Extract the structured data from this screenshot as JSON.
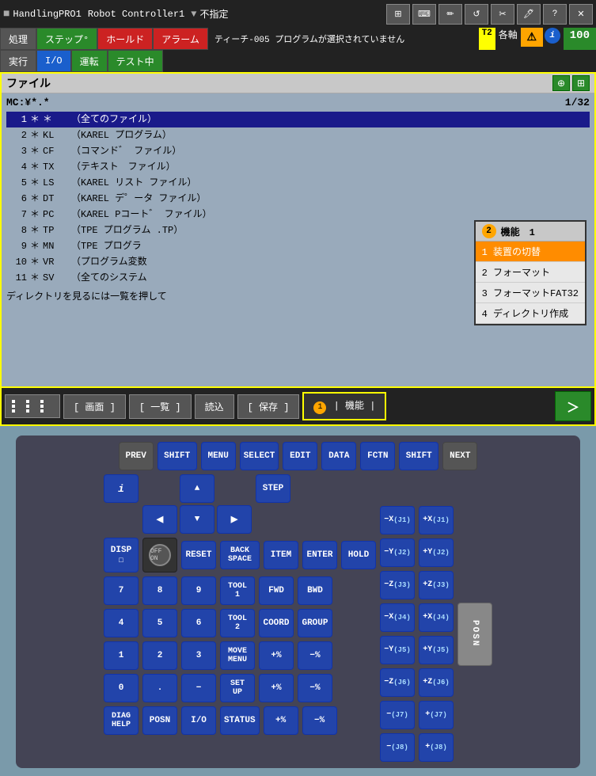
{
  "app": {
    "title": "HandlingPRO1",
    "controller": "Robot Controller1",
    "unspecified": "不指定"
  },
  "top_icons": [
    "grid-icon",
    "keyboard-icon",
    "pen-icon",
    "refresh-icon",
    "tool-icon",
    "pen2-icon",
    "question-icon",
    "x-icon"
  ],
  "menu": {
    "items": [
      {
        "label": "処理",
        "style": "gray"
      },
      {
        "label": "ステップ°",
        "style": "green"
      },
      {
        "label": "ホールド",
        "style": "red"
      },
      {
        "label": "アラーム",
        "style": "red"
      },
      {
        "label": "実行",
        "style": "gray"
      },
      {
        "label": "I/O",
        "style": "active-blue"
      },
      {
        "label": "運転",
        "style": "green"
      },
      {
        "label": "テスト中",
        "style": "green"
      }
    ],
    "info_text": "ティーチ-005 プログラムが選択されていません",
    "t2_label": "T2",
    "axes_label": "各軸",
    "percent": "100"
  },
  "file_panel": {
    "title": "ファイル",
    "path": "MC:¥*.*",
    "pagination": "1/32",
    "rows": [
      {
        "num": "1",
        "star": "*",
        "code": "*",
        "desc": "（全てのファイル）",
        "selected": true
      },
      {
        "num": "2",
        "star": "*",
        "code": "KL",
        "desc": "（KAREL プログラム）"
      },
      {
        "num": "3",
        "star": "*",
        "code": "CF",
        "desc": "（コマンド゛ファイル）"
      },
      {
        "num": "4",
        "star": "*",
        "code": "TX",
        "desc": "（テキスト　ファイル）"
      },
      {
        "num": "5",
        "star": "*",
        "code": "LS",
        "desc": "（KAREL リスト ファイル）"
      },
      {
        "num": "6",
        "star": "*",
        "code": "DT",
        "desc": "（KAREL デ°ータ ファイル）"
      },
      {
        "num": "7",
        "star": "*",
        "code": "PC",
        "desc": "（KAREL Pコート゛ ファイル）"
      },
      {
        "num": "8",
        "star": "*",
        "code": "TP",
        "desc": "（TPE プログラム .TP）"
      },
      {
        "num": "9",
        "star": "*",
        "code": "MN",
        "desc": "（TPE プログラ"
      },
      {
        "num": "10",
        "star": "*",
        "code": "VR",
        "desc": "（プログラム変数"
      },
      {
        "num": "11",
        "star": "*",
        "code": "SV",
        "desc": "（全てのシステム"
      }
    ],
    "dir_note": "ディレクトリを見るには一覧を押して"
  },
  "context_menu": {
    "badge_num": "2",
    "title": "機能　1",
    "items": [
      {
        "label": "1 装置の切替",
        "active": true
      },
      {
        "label": "2 フォーマット",
        "active": false
      },
      {
        "label": "3 フォーマットFAT32",
        "active": false
      },
      {
        "label": "4 ディレクトリ作成",
        "active": false
      }
    ]
  },
  "toolbar": {
    "badge_num": "1",
    "buttons": [
      {
        "label": "[ 画面 ]"
      },
      {
        "label": "[ 一覧 ]"
      },
      {
        "label": "読込"
      },
      {
        "label": "[ 保存 ]"
      },
      {
        "label": "| 機能 |",
        "active": true
      }
    ],
    "arrow_label": "＞"
  },
  "keyboard": {
    "top_row": [
      "PREV",
      "SHIFT",
      "MENU",
      "SELECT",
      "EDIT",
      "DATA",
      "FCTN",
      "SHIFT",
      "NEXT"
    ],
    "info_key": "i",
    "disp_label": "DISP",
    "off_on": "OFF  ON",
    "reset": "RESET",
    "back_space": "BACK\nSPACE",
    "item": "ITEM",
    "enter": "ENTER",
    "step": "STEP",
    "hold": "HOLD",
    "fwd": "FWD",
    "bwd": "BWD",
    "tool1": "TOOL\n1",
    "tool2": "TOOL\n2",
    "move_menu": "MOVE\nMENU",
    "coord": "COORD",
    "group": "GROUP",
    "set_up": "SET\nUP",
    "diag_help": "DIAG\nHELP",
    "posn_bottom": "POSN",
    "io_bottom": "I/O",
    "status_bottom": "STATUS",
    "num_keys": [
      "7",
      "8",
      "9",
      "4",
      "5",
      "6",
      "1",
      "2",
      "3",
      "0",
      ".",
      "-"
    ],
    "axis_keys": [
      {
        "-x": "−X",
        "j": "(J1)",
        "+x": "+X",
        "j2": "(J1)"
      },
      {
        "-y": "−Y",
        "j": "(J2)",
        "+y": "+Y",
        "j2": "(J2)"
      },
      {
        "-z": "−Z",
        "j": "(J3)",
        "+z": "+Z",
        "j2": "(J3)"
      },
      {
        "-x4": "−X",
        "j": "(J4)",
        "+x4": "+X",
        "j2": "(J4)"
      },
      {
        "-y5": "−Y",
        "j": "(J5)",
        "+y5": "+Y",
        "j2": "(J5)"
      },
      {
        "-z6": "−Z",
        "j": "(J6)",
        "+z6": "+Z",
        "j2": "(J6)"
      },
      {
        "-j7": "−",
        "j": "(J7)",
        "+j7": "+",
        "j2": "(J7)"
      },
      {
        "-j8": "−",
        "j": "(J8)",
        "+j8": "+",
        "j2": "(J8)"
      }
    ],
    "plus_pct": "+%",
    "minus_pct": "−%",
    "posn": "POSN"
  }
}
